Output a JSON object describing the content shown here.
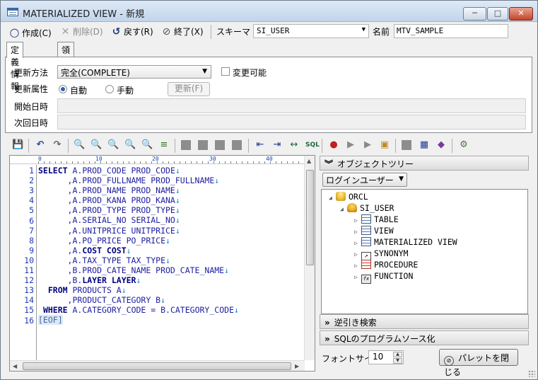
{
  "window": {
    "title": "MATERIALIZED VIEW - 新規",
    "controls": {
      "minimize": "─",
      "maximize": "□",
      "close": "✕"
    }
  },
  "toolbar": {
    "create": "作成(C)",
    "delete": "削除(D)",
    "back": "戻す(R)",
    "exit": "終了(X)",
    "schema_label": "スキーマ",
    "schema_value": "SI_USER",
    "name_label": "名前",
    "name_value": "MTV_SAMPLE"
  },
  "tabs": [
    {
      "label": "定義情報",
      "active": true
    },
    {
      "label": "領域情報",
      "active": false
    }
  ],
  "definition": {
    "refresh_method_label": "更新方法",
    "refresh_method_value": "完全(COMPLETE)",
    "modifiable_label": "変更可能",
    "refresh_attr_label": "更新属性",
    "auto_label": "自動",
    "manual_label": "手動",
    "refresh_button": "更新(F)",
    "start_label": "開始日時",
    "next_label": "次回日時"
  },
  "editor": {
    "ruler_marks": [
      "0",
      "10",
      "20",
      "30",
      "40"
    ],
    "line_numbers": [
      "1",
      "2",
      "3",
      "4",
      "5",
      "6",
      "7",
      "8",
      "9",
      "10",
      "11",
      "12",
      "13",
      "14",
      "15",
      "16"
    ],
    "lines": [
      [
        "kw:SELECT",
        " A.PROD_CODE PROD_CODE",
        "crlf:↓"
      ],
      [
        "      ,A.PROD_FULLNAME PROD_FULLNAME",
        "crlf:↓"
      ],
      [
        "      ,A.PROD_NAME PROD_NAME",
        "crlf:↓"
      ],
      [
        "      ,A.PROD_KANA PROD_KANA",
        "crlf:↓"
      ],
      [
        "      ,A.PROD_TYPE PROD_TYPE",
        "crlf:↓"
      ],
      [
        "      ,A.SERIAL_NO SERIAL_NO",
        "crlf:↓"
      ],
      [
        "      ,A.UNITPRICE UNITPRICE",
        "crlf:↓"
      ],
      [
        "      ,A.PO_PRICE PO_PRICE",
        "crlf:↓"
      ],
      [
        "      ,A.",
        "kw:COST COST",
        "crlf:↓"
      ],
      [
        "      ,A.TAX_TYPE TAX_TYPE",
        "crlf:↓"
      ],
      [
        "      ,B.PROD_CATE_NAME PROD_CATE_NAME",
        "crlf:↓"
      ],
      [
        "      ,B.",
        "kw:LAYER LAYER",
        "crlf:↓"
      ],
      [
        "  ",
        "kw:FROM",
        " PRODUCTS A",
        "crlf:↓"
      ],
      [
        "      ,PRODUCT_CATEGORY B",
        "crlf:↓"
      ],
      [
        " ",
        "kw:WHERE",
        " A.CATEGORY_CODE = B.CATEGORY_CODE",
        "crlf:↓"
      ],
      [
        "eof:[EOF]"
      ]
    ]
  },
  "right_panel": {
    "object_tree_header": "オブジェクトツリー",
    "login_user_combo": "ログインユーザー",
    "tree": [
      {
        "label": "ORCL",
        "icon": "database-icon",
        "level": 0
      },
      {
        "label": "SI_USER",
        "icon": "user-icon",
        "level": 1
      },
      {
        "label": "TABLE",
        "icon": "table-icon",
        "level": 2
      },
      {
        "label": "VIEW",
        "icon": "view-icon",
        "level": 2
      },
      {
        "label": "MATERIALIZED VIEW",
        "icon": "materialized-view-icon",
        "level": 2
      },
      {
        "label": "SYNONYM",
        "icon": "synonym-icon",
        "level": 2
      },
      {
        "label": "PROCEDURE",
        "icon": "procedure-icon",
        "level": 2
      },
      {
        "label": "FUNCTION",
        "icon": "function-icon",
        "level": 2
      }
    ],
    "reverse_search_header": "逆引き検索",
    "sql_program_header": "SQLのプログラムソース化",
    "font_size_label": "フォントサイズ",
    "font_size_value": "10",
    "close_palette_button": "パレットを閉じる"
  }
}
